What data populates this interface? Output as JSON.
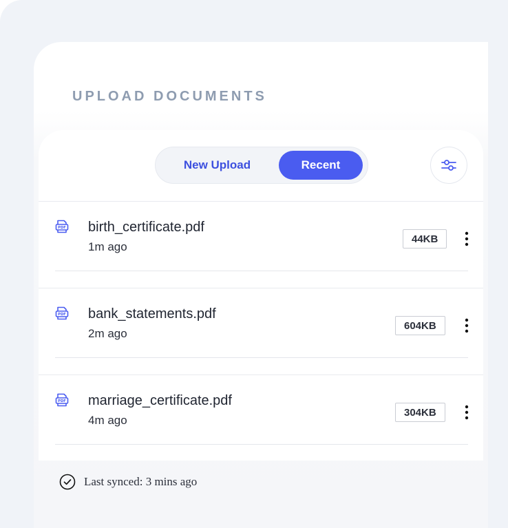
{
  "header": {
    "title": "UPLOAD DOCUMENTS"
  },
  "tabs": {
    "new_upload": "New Upload",
    "recent": "Recent",
    "active": "Recent"
  },
  "toolbar": {
    "filter_icon": "sliders-icon"
  },
  "files": [
    {
      "name": "birth_certificate.pdf",
      "time": "1m ago",
      "size": "44KB",
      "icon": "pdf-icon"
    },
    {
      "name": "bank_statements.pdf",
      "time": "2m ago",
      "size": "604KB",
      "icon": "pdf-icon"
    },
    {
      "name": "marriage_certificate.pdf",
      "time": "4m ago",
      "size": "304KB",
      "icon": "pdf-icon"
    }
  ],
  "footer": {
    "sync_text": "Last synced: 3 mins ago",
    "icon": "check-circle-icon"
  },
  "colors": {
    "accent": "#4a5cf0",
    "accent_text": "#3d50df",
    "title": "#8e9cb0"
  }
}
